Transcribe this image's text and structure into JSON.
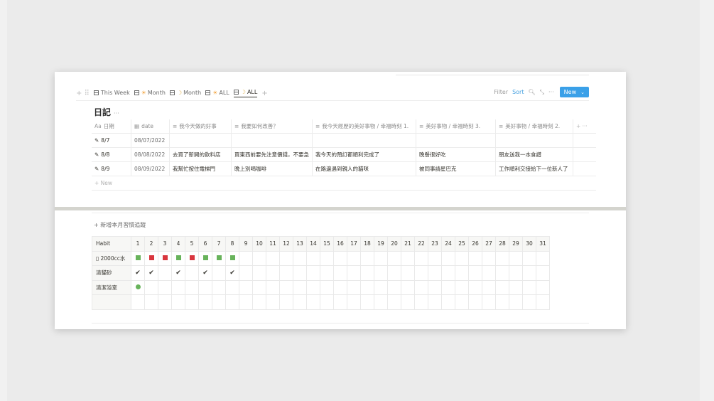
{
  "views": {
    "items": [
      {
        "label": "This Week",
        "prefix": ""
      },
      {
        "label": "Month",
        "prefix": "☀"
      },
      {
        "label": "Month",
        "prefix": "☽"
      },
      {
        "label": "ALL",
        "prefix": "☀"
      },
      {
        "label": "ALL",
        "prefix": "☽"
      }
    ],
    "active_index": 4
  },
  "toolbar": {
    "filter": "Filter",
    "sort": "Sort",
    "new": "New"
  },
  "db_title": "日記",
  "diary": {
    "headers": [
      "日期",
      "date",
      "我今天做的好事",
      "我要如何改善？",
      "我今天經歷的美好事物 / 幸福時刻 1.",
      "美好事物 / 幸福時刻 3.",
      "美好事物 / 幸福時刻 2."
    ],
    "rows": [
      [
        "8/7",
        "08/07/2022",
        "",
        "",
        "",
        "",
        ""
      ],
      [
        "8/8",
        "08/08/2022",
        "去買了新開的飲料店",
        "買東西前要先注意價錢，不要急",
        "我今天的預訂都順利完成了",
        "晚餐很好吃",
        "朋友送我一本食譜"
      ],
      [
        "8/9",
        "08/09/2022",
        "我幫忙按住電梯門",
        "晚上別喝咖啡",
        "在路邊遇到親人的貓咪",
        "被同事請星巴克",
        "工作順利交接給下一位新人了"
      ]
    ],
    "new_label": "New"
  },
  "habit_title": "新增本月習慣追蹤",
  "habit": {
    "header": "Habit",
    "days": [
      "1",
      "2",
      "3",
      "4",
      "5",
      "6",
      "7",
      "8",
      "9",
      "10",
      "11",
      "12",
      "13",
      "14",
      "15",
      "16",
      "17",
      "18",
      "19",
      "20",
      "21",
      "22",
      "23",
      "24",
      "25",
      "26",
      "27",
      "28",
      "29",
      "30",
      "31"
    ],
    "rows": [
      {
        "name": "▯ 2000cc水",
        "marks": {
          "1": "green",
          "2": "red",
          "3": "red",
          "4": "green",
          "5": "red",
          "6": "green",
          "7": "green",
          "8": "green"
        }
      },
      {
        "name": "清貓砂",
        "marks": {
          "1": "check",
          "2": "check",
          "4": "check",
          "6": "check",
          "8": "check"
        }
      },
      {
        "name": "清潔浴室",
        "marks": {
          "1": "dot"
        }
      },
      {
        "name": "",
        "marks": {}
      }
    ]
  },
  "colors": {
    "accent": "#3aa0e8",
    "green": "#68b35b",
    "red": "#d9363e"
  }
}
